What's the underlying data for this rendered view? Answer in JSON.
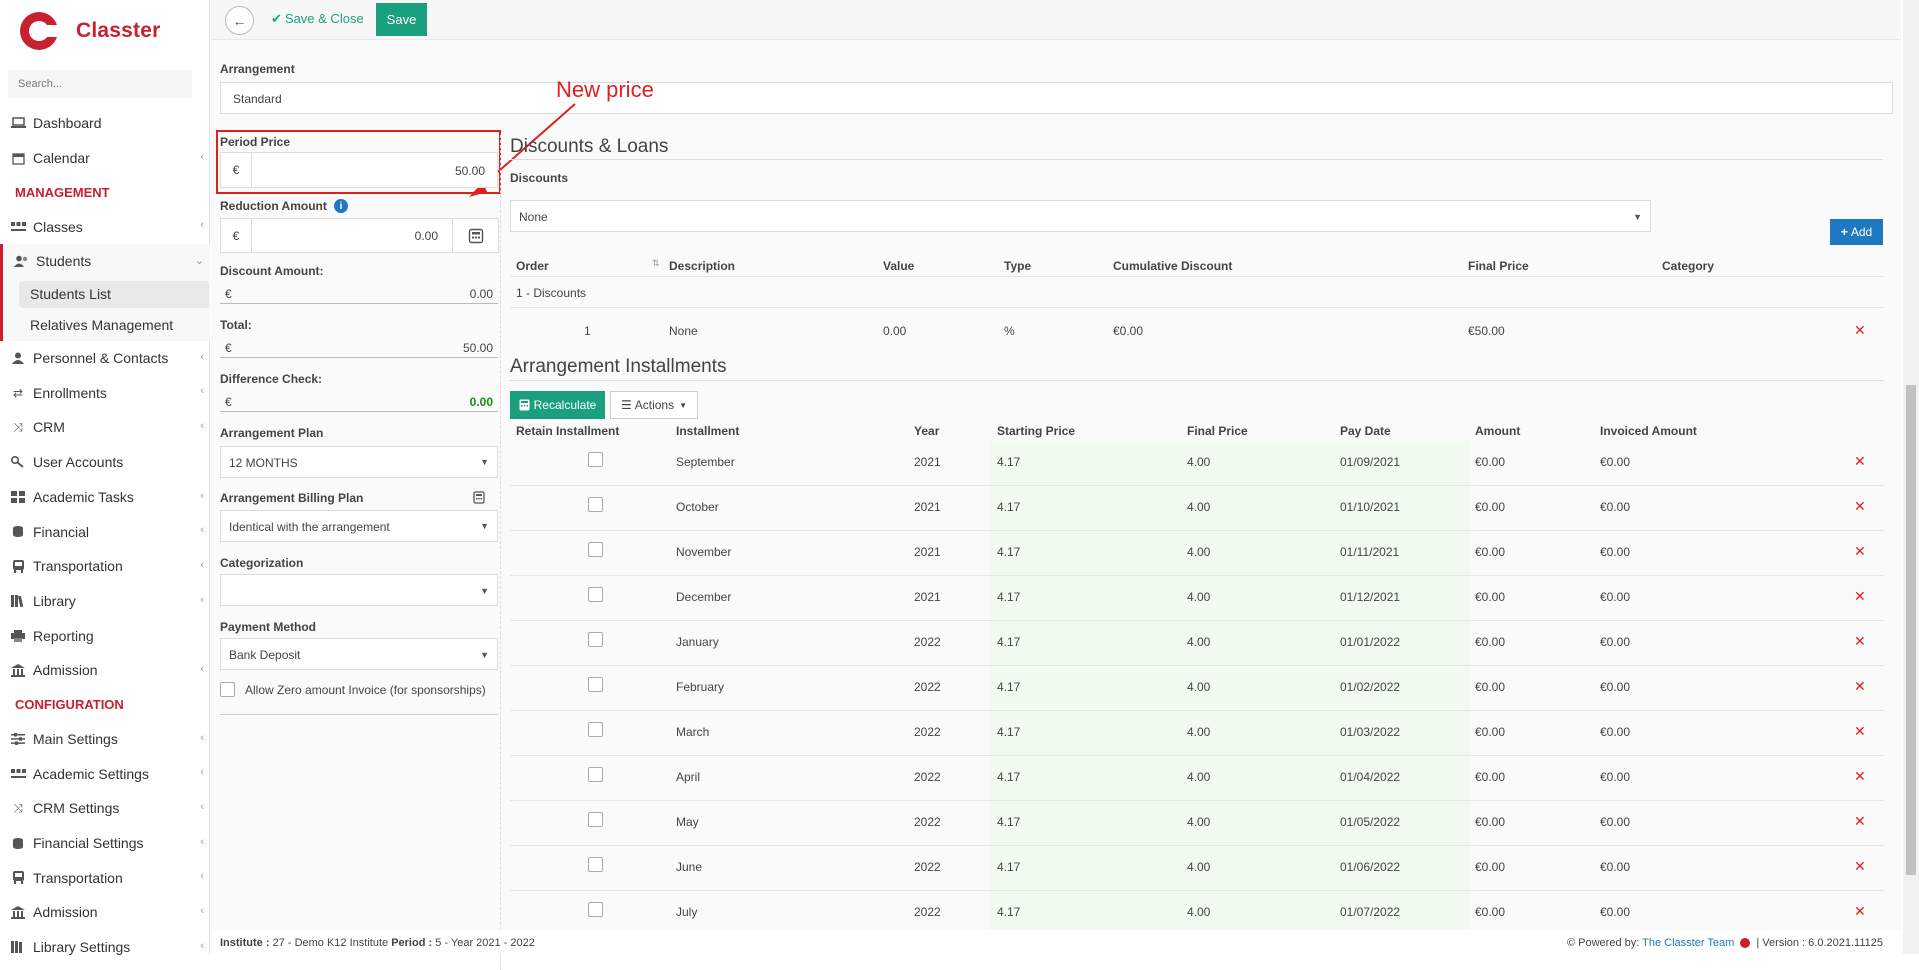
{
  "app": {
    "name": "Classter",
    "search_placeholder": "Search..."
  },
  "sidebar": {
    "items_top": [
      {
        "label": "Dashboard",
        "icon": "laptop-icon"
      },
      {
        "label": "Calendar",
        "icon": "calendar-icon"
      }
    ],
    "section_management": "MANAGEMENT",
    "classes": "Classes",
    "students": "Students",
    "students_list": "Students List",
    "relatives": "Relatives Management",
    "items_mgmt": [
      {
        "label": "Personnel & Contacts"
      },
      {
        "label": "Enrollments"
      },
      {
        "label": "CRM"
      },
      {
        "label": "User Accounts"
      },
      {
        "label": "Academic Tasks"
      },
      {
        "label": "Financial"
      },
      {
        "label": "Transportation"
      },
      {
        "label": "Library"
      },
      {
        "label": "Reporting"
      },
      {
        "label": "Admission"
      }
    ],
    "section_config": "CONFIGURATION",
    "items_config": [
      {
        "label": "Main Settings"
      },
      {
        "label": "Academic Settings"
      },
      {
        "label": "CRM Settings"
      },
      {
        "label": "Financial Settings"
      },
      {
        "label": "Transportation"
      },
      {
        "label": "Admission"
      },
      {
        "label": "Library Settings"
      }
    ]
  },
  "toolbar": {
    "save_close": "Save & Close",
    "save": "Save"
  },
  "form": {
    "arrangement_label": "Arrangement",
    "arrangement_value": "Standard",
    "period_price_label": "Period Price",
    "currency": "€",
    "period_price_value": "50.00",
    "reduction_label": "Reduction Amount",
    "reduction_value": "0.00",
    "discount_label": "Discount Amount:",
    "discount_value": "0.00",
    "total_label": "Total:",
    "total_value": "50.00",
    "diff_label": "Difference Check:",
    "diff_value": "0.00",
    "plan_label": "Arrangement Plan",
    "plan_value": "12 MONTHS",
    "billing_label": "Arrangement Billing Plan",
    "billing_value": "Identical with the arrangement",
    "categorization_label": "Categorization",
    "categorization_value": "",
    "payment_label": "Payment Method",
    "payment_value": "Bank Deposit",
    "zero_label": "Allow Zero amount Invoice (for sponsorships)"
  },
  "annotation": "New price",
  "discounts": {
    "title": "Discounts & Loans",
    "label": "Discounts",
    "select_value": "None",
    "add": "Add",
    "headers": [
      "Order",
      "Description",
      "Value",
      "Type",
      "Cumulative Discount",
      "Final Price",
      "Category"
    ],
    "group": "1 - Discounts",
    "row": {
      "order": "1",
      "description": "None",
      "value": "0.00",
      "type": "%",
      "cumulative": "€0.00",
      "final": "€50.00",
      "category": ""
    }
  },
  "installments": {
    "title": "Arrangement Installments",
    "recalculate": "Recalculate",
    "actions": "Actions",
    "headers": [
      "Retain Installment",
      "Installment",
      "Year",
      "Starting Price",
      "Final Price",
      "Pay Date",
      "Amount",
      "Invoiced Amount"
    ],
    "rows": [
      {
        "name": "September",
        "year": "2021",
        "start": "4.17",
        "final": "4.00",
        "date": "01/09/2021",
        "amount": "€0.00",
        "invoiced": "€0.00"
      },
      {
        "name": "October",
        "year": "2021",
        "start": "4.17",
        "final": "4.00",
        "date": "01/10/2021",
        "amount": "€0.00",
        "invoiced": "€0.00"
      },
      {
        "name": "November",
        "year": "2021",
        "start": "4.17",
        "final": "4.00",
        "date": "01/11/2021",
        "amount": "€0.00",
        "invoiced": "€0.00"
      },
      {
        "name": "December",
        "year": "2021",
        "start": "4.17",
        "final": "4.00",
        "date": "01/12/2021",
        "amount": "€0.00",
        "invoiced": "€0.00"
      },
      {
        "name": "January",
        "year": "2022",
        "start": "4.17",
        "final": "4.00",
        "date": "01/01/2022",
        "amount": "€0.00",
        "invoiced": "€0.00"
      },
      {
        "name": "February",
        "year": "2022",
        "start": "4.17",
        "final": "4.00",
        "date": "01/02/2022",
        "amount": "€0.00",
        "invoiced": "€0.00"
      },
      {
        "name": "March",
        "year": "2022",
        "start": "4.17",
        "final": "4.00",
        "date": "01/03/2022",
        "amount": "€0.00",
        "invoiced": "€0.00"
      },
      {
        "name": "April",
        "year": "2022",
        "start": "4.17",
        "final": "4.00",
        "date": "01/04/2022",
        "amount": "€0.00",
        "invoiced": "€0.00"
      },
      {
        "name": "May",
        "year": "2022",
        "start": "4.17",
        "final": "4.00",
        "date": "01/05/2022",
        "amount": "€0.00",
        "invoiced": "€0.00"
      },
      {
        "name": "June",
        "year": "2022",
        "start": "4.17",
        "final": "4.00",
        "date": "01/06/2022",
        "amount": "€0.00",
        "invoiced": "€0.00"
      },
      {
        "name": "July",
        "year": "2022",
        "start": "4.17",
        "final": "4.00",
        "date": "01/07/2022",
        "amount": "€0.00",
        "invoiced": "€0.00"
      }
    ]
  },
  "footer": {
    "institute_label": "Institute :",
    "institute_value": "27 - Demo K12 Institute",
    "period_label": "Period :",
    "period_value": "5 - Year 2021 - 2022",
    "powered": "Powered by:",
    "team": "The Classter Team",
    "version": "| Version : 6.0.2021.11125"
  },
  "colors": {
    "brand": "#c8202f",
    "green": "#1aa07f",
    "blue": "#1e78c2",
    "annotation": "#e01f1f"
  }
}
